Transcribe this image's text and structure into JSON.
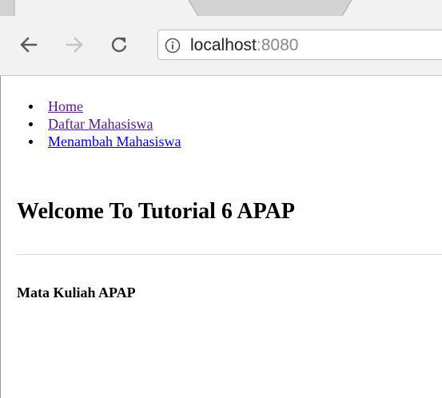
{
  "browser": {
    "url_host": "localhost",
    "url_port": ":8080",
    "icons": {
      "back": "arrow-left-icon",
      "forward": "arrow-right-icon",
      "reload": "reload-icon",
      "site_info": "info-icon"
    }
  },
  "nav": {
    "items": [
      {
        "label": "Home",
        "state": "visited"
      },
      {
        "label": "Daftar Mahasiswa",
        "state": "visited"
      },
      {
        "label": "Menambah Mahasiswa",
        "state": "unvisited"
      }
    ]
  },
  "page": {
    "title": "Welcome To Tutorial 6 APAP",
    "subtitle": "Mata Kuliah APAP"
  },
  "colors": {
    "link_visited": "#551a8b",
    "link_unvisited": "#0000ee",
    "toolbar_bg": "#f2f2f2",
    "tabstrip_bg": "#d2d2d2"
  }
}
